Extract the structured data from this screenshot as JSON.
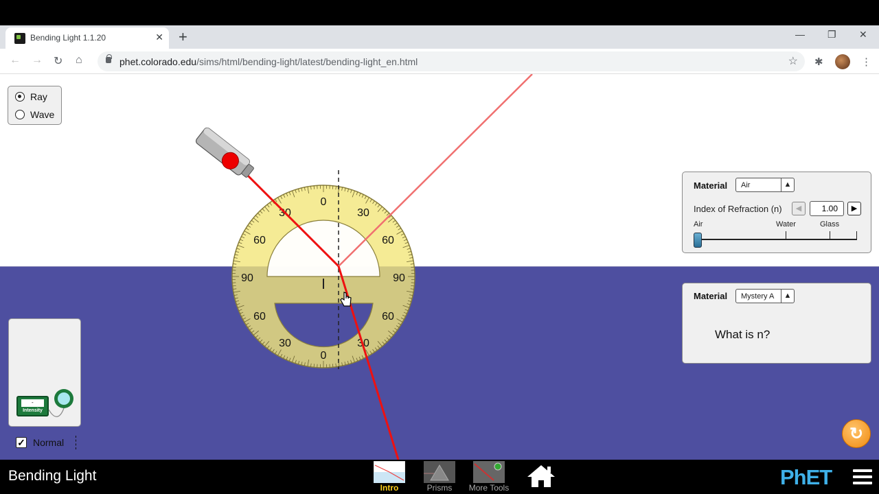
{
  "browser": {
    "tab_title": "Bending Light 1.1.20",
    "url_host": "phet.colorado.edu",
    "url_path": "/sims/html/bending-light/latest/bending-light_en.html"
  },
  "mode": {
    "options": [
      "Ray",
      "Wave"
    ],
    "selected": "Ray"
  },
  "protractor": {
    "labels_upper": [
      "30",
      "0",
      "30",
      "60",
      "60",
      "90",
      "90"
    ],
    "labels_lower": [
      "60",
      "60",
      "30",
      "0",
      "30"
    ]
  },
  "top_material": {
    "label": "Material",
    "value": "Air",
    "ior_label": "Index of Refraction (n)",
    "ior_value": "1.00",
    "slider_labels": [
      "Air",
      "Water",
      "Glass"
    ],
    "slider_value": 1.0
  },
  "bottom_material": {
    "label": "Material",
    "value": "Mystery A",
    "question": "What is n?"
  },
  "sensor": {
    "meter_label": "Intensity",
    "meter_value": "-"
  },
  "normal_checkbox": {
    "label": "Normal",
    "checked": true
  },
  "navbar": {
    "title": "Bending Light",
    "screens": [
      "Intro",
      "Prisms",
      "More Tools"
    ],
    "active_screen": "Intro",
    "logo": "PhET"
  },
  "colors": {
    "water": "#4e4fa0",
    "laser": "#ee1111",
    "protractor": "#f3e67a"
  }
}
